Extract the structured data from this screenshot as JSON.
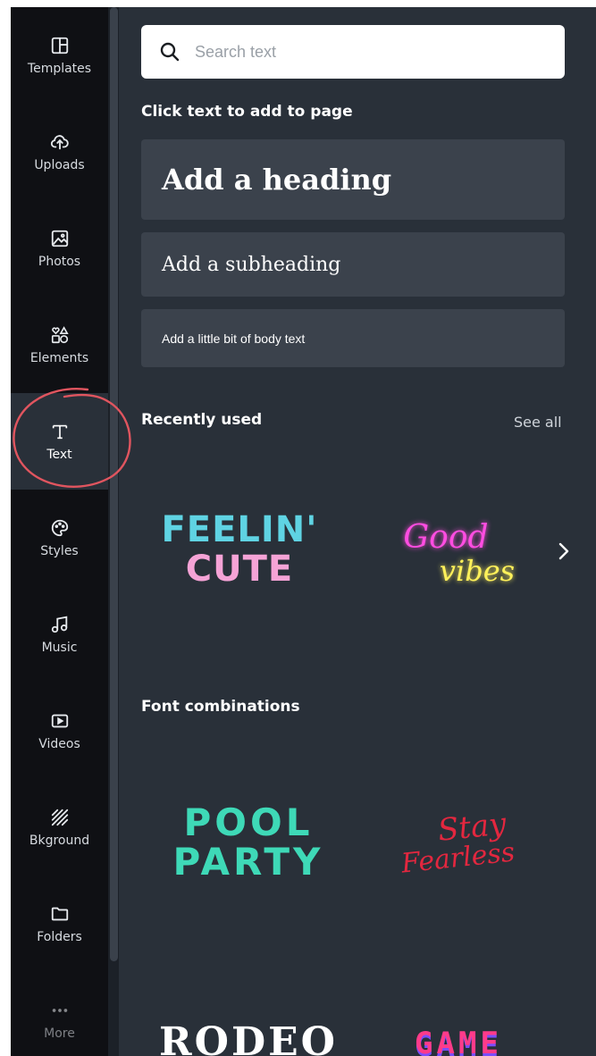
{
  "rail": {
    "items": [
      {
        "label": "Templates",
        "icon": "templates-icon"
      },
      {
        "label": "Uploads",
        "icon": "upload-cloud-icon"
      },
      {
        "label": "Photos",
        "icon": "image-icon"
      },
      {
        "label": "Elements",
        "icon": "shapes-icon"
      },
      {
        "label": "Text",
        "icon": "text-icon",
        "active": true
      },
      {
        "label": "Styles",
        "icon": "palette-icon"
      },
      {
        "label": "Music",
        "icon": "music-note-icon"
      },
      {
        "label": "Videos",
        "icon": "video-play-icon"
      },
      {
        "label": "Bkground",
        "icon": "background-hatch-icon"
      },
      {
        "label": "Folders",
        "icon": "folder-icon"
      },
      {
        "label": "More",
        "icon": "more-dots-icon"
      }
    ]
  },
  "panel": {
    "search": {
      "placeholder": "Search text"
    },
    "click_title": "Click text to add to page",
    "heading_label": "Add a heading",
    "subheading_label": "Add a subheading",
    "body_label": "Add a little bit of body text",
    "recent_title": "Recently used",
    "see_all": "See all",
    "font_combo_title": "Font combinations",
    "recent": {
      "feelin": {
        "line1": "FEELIN'",
        "line2": "CUTE"
      },
      "goodvibes": {
        "line1": "Good",
        "line2": "vibes"
      }
    },
    "combos": {
      "pool": {
        "line1": "POOL",
        "line2": "PARTY"
      },
      "stay": {
        "line1": "Stay",
        "line2": "Fearless"
      },
      "rodeo": {
        "line1": "RODEO"
      },
      "game": {
        "line1": "GAME"
      }
    }
  },
  "colors": {
    "rail_bg": "#0f1014",
    "panel_bg": "#293039",
    "button_bg": "#3b424c",
    "highlight": "#e0555f"
  }
}
